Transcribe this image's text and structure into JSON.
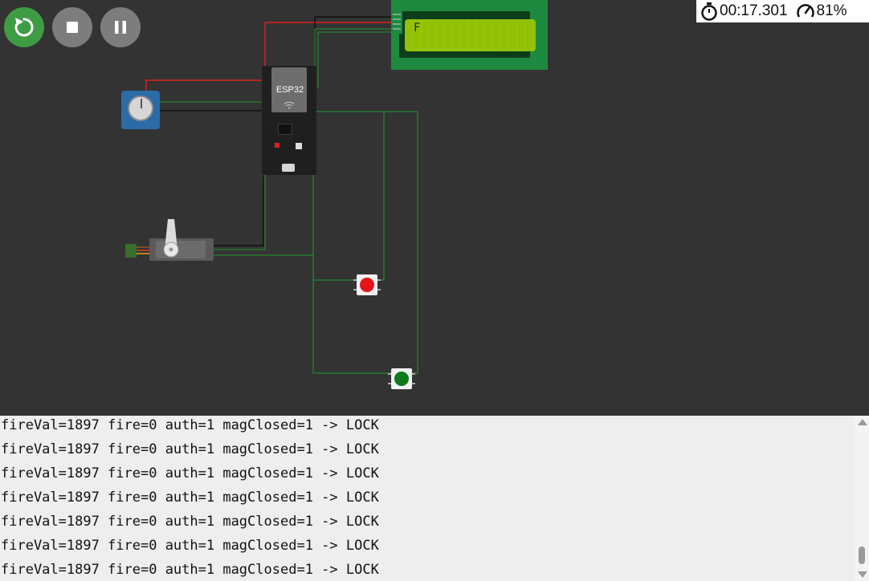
{
  "controls": [
    {
      "name": "restart",
      "icon": "restart-icon"
    },
    {
      "name": "stop",
      "icon": "stop-icon"
    },
    {
      "name": "pause",
      "icon": "pause-icon"
    }
  ],
  "status": {
    "timer_icon": "stopwatch-icon",
    "elapsed": "00:17.301",
    "speed_icon": "speed-gauge-icon",
    "speed": "81%"
  },
  "components": {
    "lcd": {
      "text": "F"
    },
    "esp32": {
      "label": "ESP32"
    }
  },
  "colors": {
    "restart_button": "#3e9c45",
    "control_buttons": "#7d7d7d",
    "canvas": "#333333",
    "wire_red": "#e0201b",
    "wire_black": "#111111",
    "wire_green": "#1f9a2f",
    "lcd_board": "#1e8a3f",
    "lcd_screen": "#9acb06",
    "console_bg": "#eeeeee"
  },
  "console": {
    "lines": [
      "fireVal=1897 fire=0 auth=1 magClosed=1 -> LOCK",
      "fireVal=1897 fire=0 auth=1 magClosed=1 -> LOCK",
      "fireVal=1897 fire=0 auth=1 magClosed=1 -> LOCK",
      "fireVal=1897 fire=0 auth=1 magClosed=1 -> LOCK",
      "fireVal=1897 fire=0 auth=1 magClosed=1 -> LOCK",
      "fireVal=1897 fire=0 auth=1 magClosed=1 -> LOCK",
      "fireVal=1897 fire=0 auth=1 magClosed=1 -> LOCK"
    ]
  }
}
